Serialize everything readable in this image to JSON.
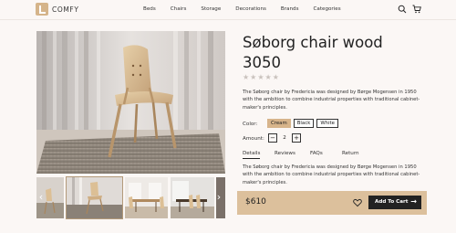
{
  "header": {
    "logo_text": "COMFY",
    "logo_icon": "comfy-logo-icon",
    "nav": [
      "Beds",
      "Chairs",
      "Storage",
      "Decorations",
      "Brands",
      "Categories"
    ],
    "icons": [
      "search-icon",
      "cart-icon"
    ]
  },
  "product": {
    "title": "Søborg chair wood 3050",
    "stars": "★★★★★",
    "rating_filled": 5,
    "description": "The Søborg chair by Fredericia was designed by Børge Mogensen in 1950 with the ambition to combine industrial properties with traditional cabinet-maker's principles.",
    "color_label": "Color:",
    "colors": [
      "Cream",
      "Black",
      "White"
    ],
    "selected_color": "Cream",
    "amount_label": "Amount:",
    "amount": "2",
    "minus": "−",
    "plus": "+"
  },
  "tabs": {
    "items": [
      "Details",
      "Reviews",
      "FAQs",
      "Return"
    ],
    "active": "Details",
    "content": "The Søborg chair by Fredericia was designed by Børge Mogensen in 1950 with the ambition to combine industrial properties with traditional cabinet-maker's principles."
  },
  "purchase": {
    "price": "$610",
    "add_to_cart": "Add To Cart",
    "arrow": "→",
    "icons": [
      "heart-icon",
      "arrow-right-icon"
    ]
  },
  "gallery": {
    "prev": "‹",
    "next": "›",
    "icons": [
      "chevron-left-icon",
      "chevron-right-icon"
    ]
  },
  "colors": {
    "accent": "#d7b48b",
    "price_bar": "#dcc09c",
    "dark": "#222222",
    "background": "#fbf7f5"
  }
}
